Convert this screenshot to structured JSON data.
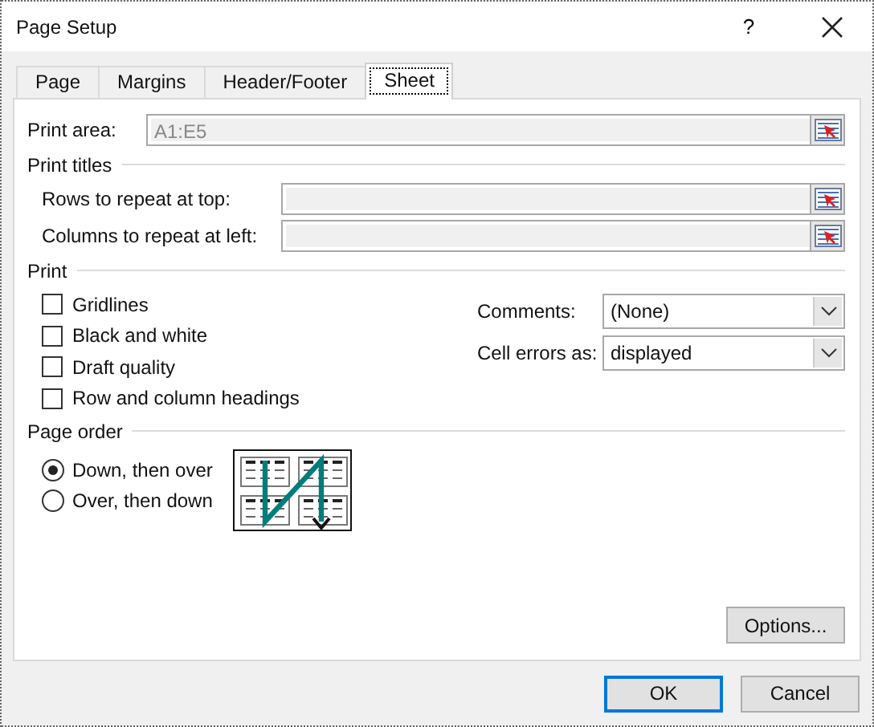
{
  "window": {
    "title": "Page Setup",
    "help": "?"
  },
  "tabs": [
    {
      "label": "Page",
      "selected": false
    },
    {
      "label": "Margins",
      "selected": false
    },
    {
      "label": "Header/Footer",
      "selected": false
    },
    {
      "label": "Sheet",
      "selected": true
    }
  ],
  "print_area": {
    "label": "Print area:",
    "value": "A1:E5"
  },
  "print_titles": {
    "title": "Print titles",
    "fields": [
      {
        "label": "Rows to repeat at top:"
      },
      {
        "label": "Columns to repeat at left:"
      }
    ]
  },
  "print": {
    "title": "Print",
    "checkboxes": [
      {
        "label": "Gridlines",
        "checked": false
      },
      {
        "label": "Black and white",
        "checked": false
      },
      {
        "label": "Draft quality",
        "checked": false
      },
      {
        "label": "Row and column headings",
        "checked": false
      }
    ],
    "dropdowns": [
      {
        "label": "Comments:",
        "value": "(None)"
      },
      {
        "label": "Cell errors as:",
        "value": "displayed"
      }
    ]
  },
  "page_order": {
    "title": "Page order",
    "options": [
      {
        "label": "Down, then over",
        "selected": true
      },
      {
        "label": "Over, then down",
        "selected": false
      }
    ]
  },
  "options_button": "Options...",
  "buttons": [
    {
      "label": "OK",
      "default": true
    },
    {
      "label": "Cancel",
      "default": false
    }
  ]
}
